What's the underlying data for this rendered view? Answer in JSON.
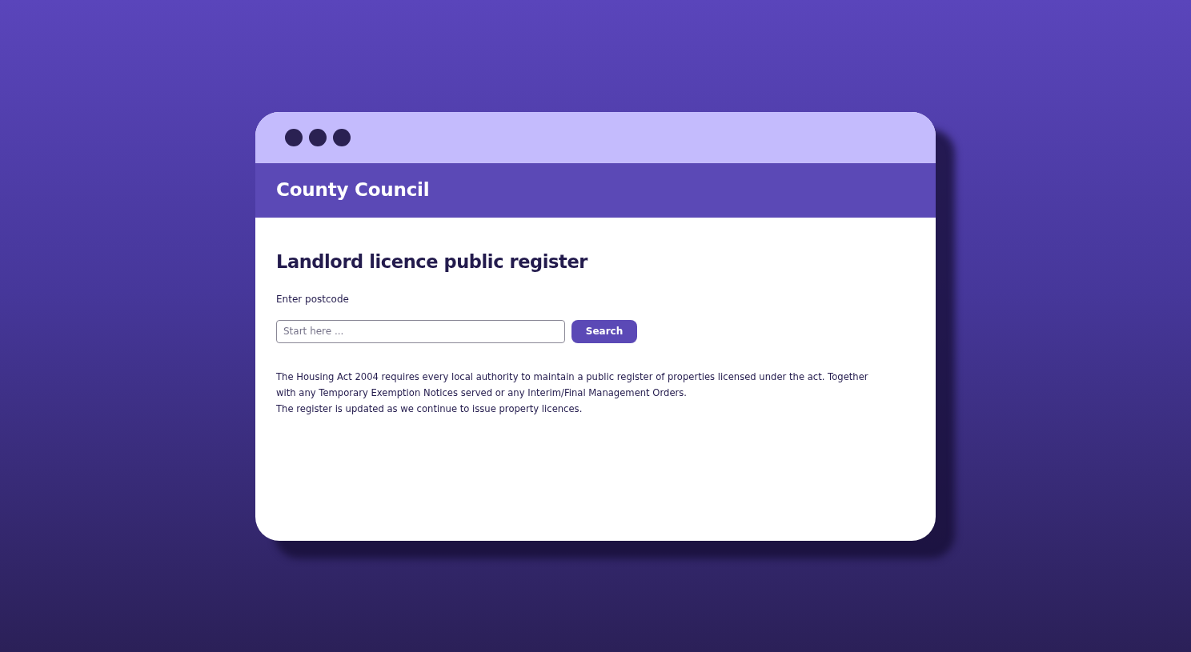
{
  "header": {
    "title": "County Council"
  },
  "page": {
    "heading": "Landlord licence public register"
  },
  "search": {
    "label": "Enter postcode",
    "placeholder": "Start here ...",
    "button": "Search"
  },
  "paragraphs": [
    "The Housing Act 2004 requires every local authority to maintain a public register of properties licensed under the act. Together with any Temporary Exemption Notices served or any Interim/Final Management Orders.",
    "The register is updated as we continue to issue property licences."
  ]
}
